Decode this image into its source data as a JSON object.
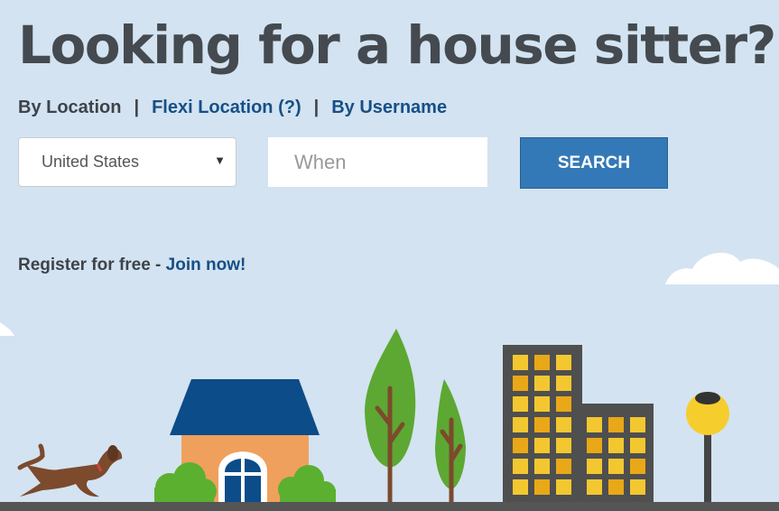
{
  "headline": "Looking for a house sitter?",
  "search_modes": {
    "by_location": "By Location",
    "flexi_location": "Flexi Location (?)",
    "by_username": "By Username",
    "separator": "|"
  },
  "form": {
    "country": "United States",
    "when_placeholder": "When",
    "search_label": "SEARCH"
  },
  "register": {
    "text": "Register for free - ",
    "link": "Join now!"
  },
  "colors": {
    "sky": "#d3e3f1",
    "headline": "#444a4f",
    "link": "#174f85",
    "button": "#3479b7"
  }
}
